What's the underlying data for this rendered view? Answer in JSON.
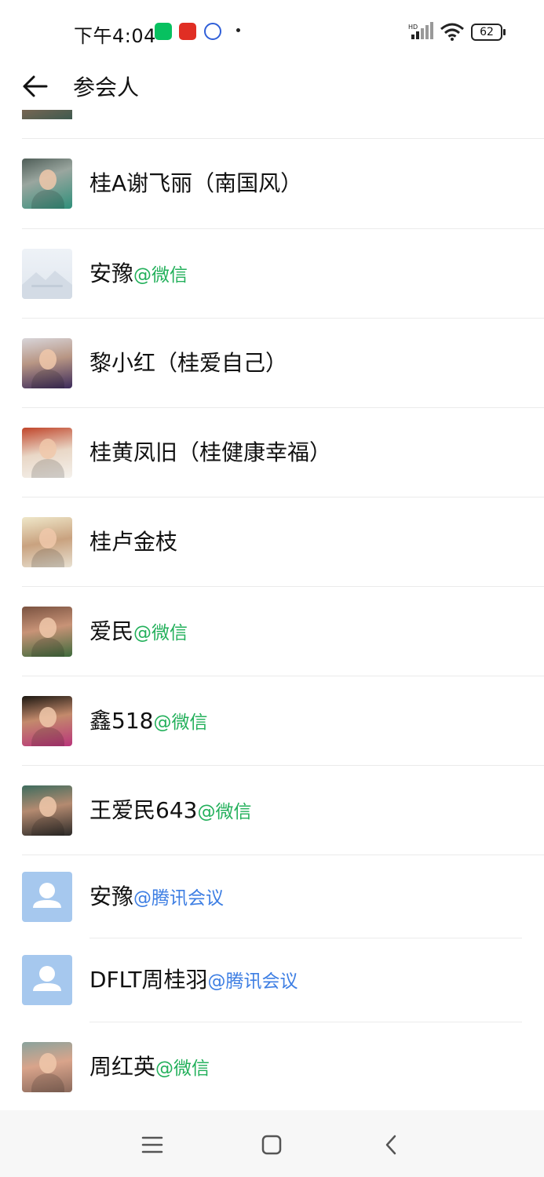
{
  "status_bar": {
    "time": "下午4:04",
    "battery": "62",
    "icons": [
      "wechat-icon",
      "pinduoduo-icon",
      "baidu-icon",
      "signal-icon",
      "wifi-icon",
      "battery-icon"
    ]
  },
  "header": {
    "title": "参会人",
    "back_icon": "arrow-left-icon"
  },
  "participants": [
    {
      "name": "桂A谢飞丽（南国风）",
      "source": ""
    },
    {
      "name": "安豫",
      "source": "@微信"
    },
    {
      "name": "黎小红（桂爱自己）",
      "source": ""
    },
    {
      "name": "桂黄凤旧（桂健康幸福）",
      "source": ""
    },
    {
      "name": "桂卢金枝",
      "source": ""
    },
    {
      "name": "爱民",
      "source": "@微信"
    },
    {
      "name": "鑫518",
      "source": "@微信"
    },
    {
      "name": "王爱民643",
      "source": "@微信"
    },
    {
      "name": "安豫",
      "source": "@腾讯会议"
    },
    {
      "name": "DFLT周桂羽",
      "source": "@腾讯会议"
    },
    {
      "name": "周红英",
      "source": "@微信"
    }
  ],
  "colors": {
    "wechat_source": "#23b05b",
    "tencent_source": "#3d7ee3",
    "default_avatar": "#a6c8ee"
  },
  "nav_bar": {
    "icons": [
      "menu-icon",
      "home-icon",
      "back-icon"
    ]
  }
}
